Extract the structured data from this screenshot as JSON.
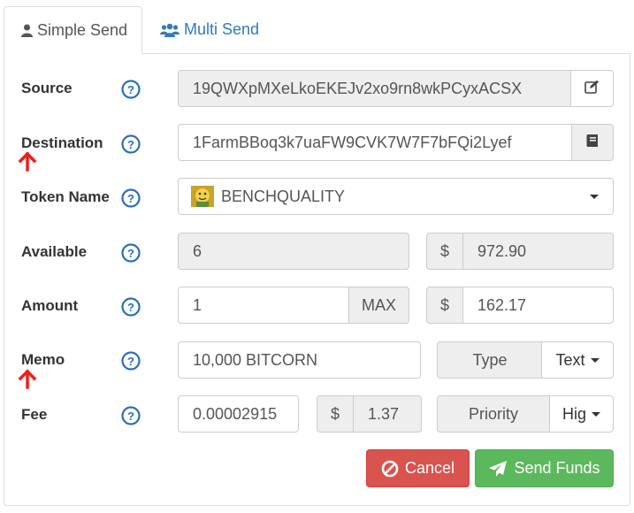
{
  "tabs": {
    "simple_send": {
      "label": "Simple Send",
      "icon": "user-icon"
    },
    "multi_send": {
      "label": "Multi Send",
      "icon": "users-icon"
    }
  },
  "form": {
    "source": {
      "label": "Source",
      "value": "19QWXpMXeLkoEKEJv2xo9rn8wkPCyxACSX",
      "icon": "edit-icon"
    },
    "destination": {
      "label": "Destination",
      "value": "1FarmBBoq3k7uaFW9CVK7W7F7bFQi2Lyef",
      "icon": "address-book-icon"
    },
    "token": {
      "label": "Token Name",
      "value": "BENCHQUALITY"
    },
    "available": {
      "label": "Available",
      "value": "6",
      "currency_symbol": "$",
      "usd_value": "972.90"
    },
    "amount": {
      "label": "Amount",
      "value": "1",
      "max_label": "MAX",
      "currency_symbol": "$",
      "usd_value": "162.17"
    },
    "memo": {
      "label": "Memo",
      "value": "10,000 BITCORN",
      "type_label": "Type",
      "type_value": "Text"
    },
    "fee": {
      "label": "Fee",
      "value": "0.00002915",
      "currency_symbol": "$",
      "usd_value": "1.37",
      "priority_label": "Priority",
      "priority_value": "Hig"
    }
  },
  "actions": {
    "cancel_label": "Cancel",
    "send_label": "Send Funds"
  },
  "colors": {
    "link_blue": "#337ab7",
    "help_icon_blue": "#2a6ebb",
    "annotation_red": "#e8221b",
    "cancel_red": "#d9534f",
    "send_green": "#5cb85c"
  }
}
